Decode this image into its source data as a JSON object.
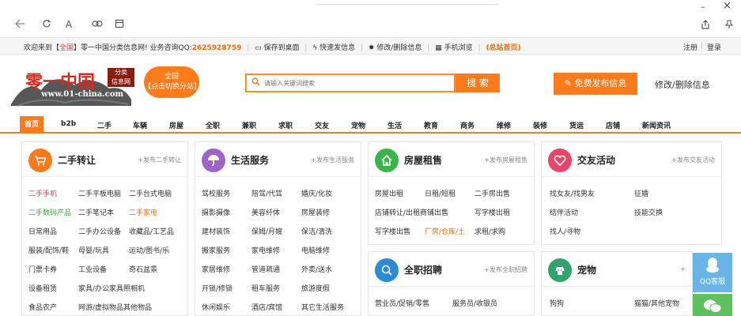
{
  "browser": {
    "min": "–",
    "close": "×",
    "icons": [
      "back-icon",
      "refresh-icon",
      "font-icon",
      "link-icon",
      "reader-icon",
      "share-icon",
      "pin-icon"
    ]
  },
  "topbar": {
    "welcome": "欢迎来到【",
    "city": "全国",
    "welcome_end": "】零一中国分类信息网!",
    "biz": "业务咨询QQ:",
    "qq": "2625928759",
    "save_desktop": "保存到桌面",
    "quick_post": "快速发信息",
    "modify_delete": "修改/删除信息",
    "mobile": "手机浏览",
    "home": "(总站首页)",
    "register": "注册",
    "login": "登录"
  },
  "header": {
    "logo_text": "零一中国",
    "logo_tag_1": "分类",
    "logo_tag_2": "信息网",
    "logo_url": "www.01-china.com",
    "city_line1": "全国",
    "city_line2": "【点击切换分站】",
    "search_placeholder": "请输入关键词搜索",
    "search_button": "搜 索",
    "publish_button": "免费发布信息",
    "modify_link": "修改/删除信息"
  },
  "nav": [
    "首页",
    "b2b",
    "二手",
    "车辆",
    "房屋",
    "全职",
    "兼职",
    "求职",
    "交友",
    "宠物",
    "生活",
    "教育",
    "商务",
    "维修",
    "装修",
    "货运",
    "店铺",
    "新闻资讯"
  ],
  "cards": [
    {
      "title": "二手转让",
      "post": "+发布二手转让",
      "color": "#ff7a1a",
      "rows": [
        [
          "二手手机",
          "二手平板电脑",
          "二手台式电脑"
        ],
        [
          "二手数码产品",
          "二手笔记本",
          "二手家电"
        ],
        [
          "日常用品",
          "二手办公设备",
          "收藏品/工艺品"
        ],
        [
          "服装/配饰/鞋",
          "母婴/玩具",
          "运动/图书/乐"
        ],
        [
          "门票卡券",
          "工业设备",
          "奇石盆景"
        ],
        [
          "设备租赁",
          "家具/办公家具照相机",
          ""
        ],
        [
          "食品农产",
          "网游/虚拟物品其他物品",
          ""
        ]
      ]
    },
    {
      "title": "生活服务",
      "post": "+发布生活服务",
      "color": "#a064c8",
      "rows": [
        [
          "驾校服务",
          "陪驾/代驾",
          "婚庆/化妆"
        ],
        [
          "摄影摄像",
          "美容纤体",
          "房屋装修"
        ],
        [
          "建材装饰",
          "保姆/月嫂",
          "保洁/清洗"
        ],
        [
          "搬家服务",
          "家电维修",
          "电脑维修"
        ],
        [
          "家居维修",
          "管道疏通",
          "外卖/送水"
        ],
        [
          "开锁/修锁",
          "租车服务",
          "旅游度假"
        ],
        [
          "休闲娱乐",
          "酒店/宾馆",
          "其它生活服务"
        ]
      ]
    },
    {
      "title": "房屋租售",
      "post": "+发布房屋租售",
      "color": "#3ab54a",
      "rows": [
        [
          "房屋出租",
          "日租/短租",
          "二手房出售"
        ],
        [
          "店铺转让/出租商铺出售",
          "",
          "写字楼出租"
        ],
        [
          "写字楼出售",
          "厂房/仓库/土",
          "求租/求购"
        ]
      ]
    },
    {
      "title": "交友活动",
      "post": "+发布交友活动",
      "color": "#e8456a",
      "rows": [
        [
          "找女友/找男友",
          "",
          "征婚"
        ],
        [
          "结伴活动",
          "",
          "技能交换"
        ],
        [
          "找人/寻物",
          "",
          ""
        ]
      ]
    },
    {
      "title": "全职招聘",
      "post": "+发布全职招聘",
      "color": "#2d8bd6",
      "rows": [
        [
          "营业员/促销/零售",
          "服务员/收银员",
          ""
        ]
      ]
    },
    {
      "title": "宠物",
      "post": "+",
      "color": "#2fa36b",
      "rows": [
        [
          "狗狗",
          "",
          "猫猫/其他宠物"
        ]
      ]
    }
  ],
  "floats": {
    "qq_label": "QQ客服"
  }
}
